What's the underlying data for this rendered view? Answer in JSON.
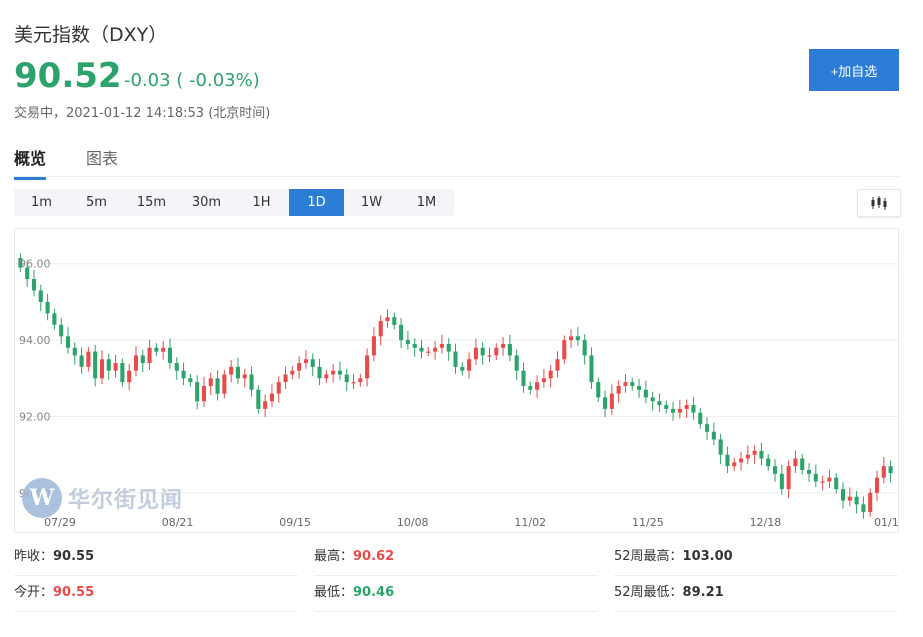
{
  "header": {
    "title": "美元指数（DXY）",
    "price": "90.52",
    "change": "-0.03 ( -0.03%)",
    "status": "交易中，2021-01-12 14:18:53 (北京时间)",
    "add_button": "+加自选"
  },
  "tabs": [
    {
      "label": "概览",
      "active": true
    },
    {
      "label": "图表",
      "active": false
    }
  ],
  "periods": [
    {
      "label": "1m",
      "active": false
    },
    {
      "label": "5m",
      "active": false
    },
    {
      "label": "15m",
      "active": false
    },
    {
      "label": "30m",
      "active": false
    },
    {
      "label": "1H",
      "active": false
    },
    {
      "label": "1D",
      "active": true
    },
    {
      "label": "1W",
      "active": false
    },
    {
      "label": "1M",
      "active": false
    }
  ],
  "chart_icon": "candlestick-icon",
  "watermark": {
    "logo": "W",
    "text": "华尔街见闻"
  },
  "colors": {
    "up": "#e94b4b",
    "down": "#2ba36a",
    "accent": "#2c7dd6"
  },
  "chart_data": {
    "type": "candlestick",
    "title": "",
    "y_ticks": [
      "96.00",
      "94.00",
      "92.00",
      "90.00"
    ],
    "ylim": [
      89.5,
      96.7
    ],
    "x_ticks": [
      "07/29",
      "08/21",
      "09/15",
      "10/08",
      "11/02",
      "11/25",
      "12/18",
      "01/1"
    ],
    "grid": true,
    "closes": [
      95.9,
      95.6,
      95.3,
      95.0,
      94.7,
      94.4,
      94.1,
      93.8,
      93.6,
      93.3,
      93.7,
      93.0,
      93.5,
      93.2,
      93.4,
      92.9,
      93.2,
      93.6,
      93.4,
      93.8,
      93.7,
      93.8,
      93.4,
      93.2,
      93.0,
      92.9,
      92.4,
      92.8,
      93.0,
      92.6,
      93.1,
      93.3,
      93.0,
      93.1,
      92.7,
      92.2,
      92.4,
      92.6,
      92.9,
      93.1,
      93.2,
      93.4,
      93.5,
      93.3,
      93.0,
      93.1,
      93.2,
      93.1,
      92.9,
      92.9,
      93.0,
      93.6,
      94.1,
      94.5,
      94.6,
      94.4,
      94.0,
      93.9,
      93.8,
      93.7,
      93.7,
      93.8,
      93.9,
      93.7,
      93.3,
      93.2,
      93.5,
      93.8,
      93.6,
      93.6,
      93.8,
      93.9,
      93.6,
      93.2,
      92.8,
      92.7,
      92.9,
      93.0,
      93.2,
      93.5,
      94.0,
      94.1,
      94.0,
      93.6,
      92.9,
      92.5,
      92.2,
      92.6,
      92.8,
      92.9,
      92.8,
      92.7,
      92.5,
      92.4,
      92.3,
      92.2,
      92.1,
      92.2,
      92.3,
      92.1,
      91.8,
      91.6,
      91.4,
      91.0,
      90.7,
      90.8,
      90.9,
      91.0,
      91.1,
      90.9,
      90.7,
      90.5,
      90.1,
      90.7,
      90.9,
      90.6,
      90.5,
      90.3,
      90.3,
      90.4,
      90.1,
      89.8,
      89.9,
      89.7,
      89.5,
      90.0,
      90.4,
      90.7,
      90.52
    ],
    "last_price": 90.52
  },
  "stats": {
    "prev_close_label": "昨收：",
    "prev_close": "90.55",
    "open_label": "今开：",
    "open": "90.55",
    "high_label": "最高：",
    "high": "90.62",
    "low_label": "最低：",
    "low": "90.46",
    "high52_label": "52周最高：",
    "high52": "103.00",
    "low52_label": "52周最低：",
    "low52": "89.21"
  }
}
